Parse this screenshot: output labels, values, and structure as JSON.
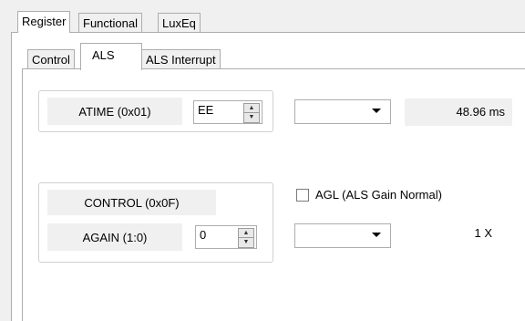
{
  "tabs_top": [
    "Register",
    "Functional",
    "LuxEq"
  ],
  "tabs_sub": [
    "Control",
    "ALS",
    "ALS Interrupt"
  ],
  "atime": {
    "label": "ATIME (0x01)",
    "value": "EE",
    "readout": "48.96 ms"
  },
  "control": {
    "title": "CONTROL (0x0F)",
    "again_label": "AGAIN (1:0)",
    "again_value": "0",
    "agl_label": "AGL (ALS Gain Normal)",
    "agl_checked": false,
    "gain_readout": "1 X"
  }
}
